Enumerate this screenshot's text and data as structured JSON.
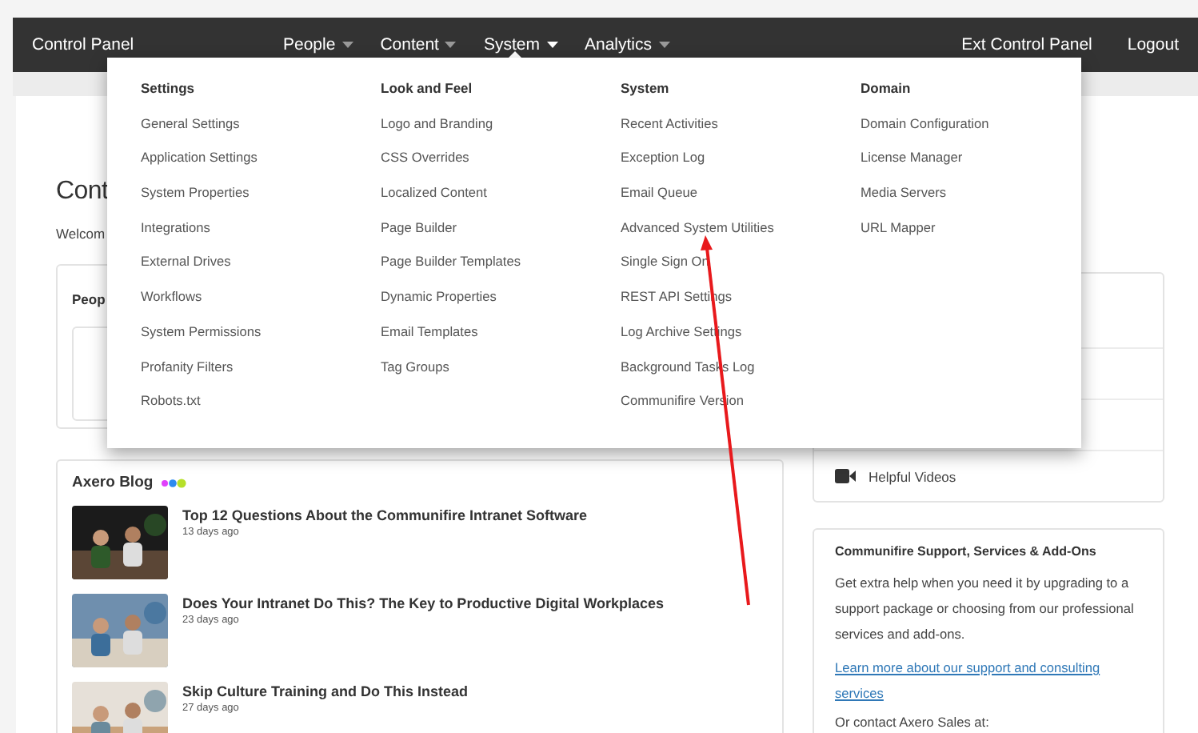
{
  "navbar": {
    "title": "Control Panel",
    "menus": [
      {
        "label": "People",
        "selected": false
      },
      {
        "label": "Content",
        "selected": false
      },
      {
        "label": "System",
        "selected": true
      },
      {
        "label": "Analytics",
        "selected": false
      }
    ],
    "links": [
      "Ext Control Panel",
      "Logout"
    ]
  },
  "page": {
    "heading": "Cont",
    "welcome": "Welcom"
  },
  "people_card": {
    "title": "Peop"
  },
  "blog": {
    "title": "Axero Blog",
    "posts": [
      {
        "title": "Top 12 Questions About the Communifire Intranet Software",
        "date": "13 days ago"
      },
      {
        "title": "Does Your Intranet Do This? The Key to Productive Digital Workplaces",
        "date": "23 days ago"
      },
      {
        "title": "Skip Culture Training and Do This Instead",
        "date": "27 days ago"
      }
    ]
  },
  "resources_card": {
    "items": [
      {
        "label": "Helpful Videos"
      }
    ]
  },
  "support_card": {
    "title": "Communifire Support, Services & Add-Ons",
    "text": "Get extra help when you need it by upgrading to a support package or choosing from our professional services and add-ons.",
    "link": "Learn more about our support and consulting services",
    "contact": "Or contact Axero Sales at:"
  },
  "dropdown": {
    "columns": [
      {
        "heading": "Settings",
        "items": [
          "General Settings",
          "Application Settings",
          "System Properties",
          "Integrations",
          "External Drives",
          "Workflows",
          "System Permissions",
          "Profanity Filters",
          "Robots.txt"
        ]
      },
      {
        "heading": "Look and Feel",
        "items": [
          "Logo and Branding",
          "CSS Overrides",
          "Localized Content",
          "Page Builder",
          "Page Builder Templates",
          "Dynamic Properties",
          "Email Templates",
          "Tag Groups"
        ]
      },
      {
        "heading": "System",
        "items": [
          "Recent Activities",
          "Exception Log",
          "Email Queue",
          "Advanced System Utilities",
          "Single Sign On",
          "REST API Settings",
          "Log Archive Settings",
          "Background Tasks Log",
          "Communifire Version"
        ]
      },
      {
        "heading": "Domain",
        "items": [
          "Domain Configuration",
          "License Manager",
          "Media Servers",
          "URL Mapper"
        ]
      }
    ]
  }
}
